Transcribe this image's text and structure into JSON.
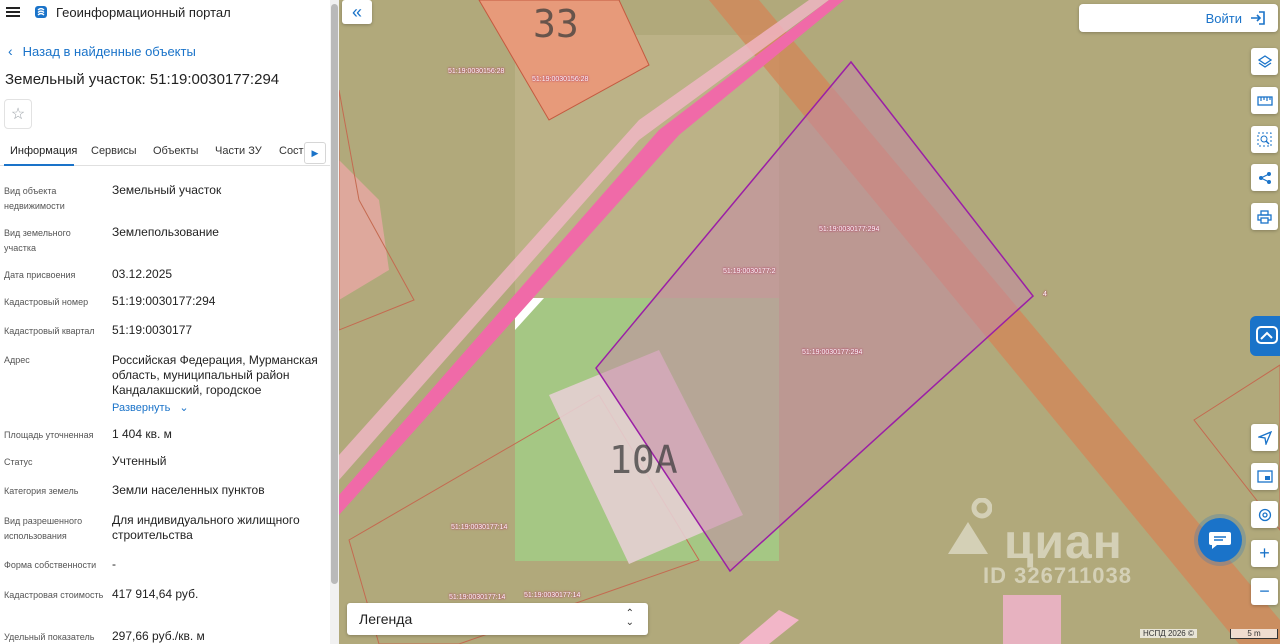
{
  "header": {
    "title": "Геоинформационный портал"
  },
  "nav": {
    "back_label": "Назад в найденные объекты"
  },
  "object": {
    "title": "Земельный участок: 51:19:0030177:294"
  },
  "tabs": [
    {
      "label": "Информация",
      "active": true
    },
    {
      "label": "Сервисы"
    },
    {
      "label": "Объекты"
    },
    {
      "label": "Части ЗУ"
    },
    {
      "label": "Соста"
    }
  ],
  "properties": [
    {
      "label": "Вид объекта недвижимости",
      "value": "Земельный участок"
    },
    {
      "label": "Вид земельного участка",
      "value": "Землепользование"
    },
    {
      "label": "Дата присвоения",
      "value": "03.12.2025"
    },
    {
      "label": "Кадастровый номер",
      "value": "51:19:0030177:294"
    },
    {
      "label": "Кадастровый квартал",
      "value": "51:19:0030177"
    },
    {
      "label": "Адрес",
      "value": "Российская Федерация, Мурманская область, муниципальный район Кандалакшский, городское"
    },
    {
      "label": "Площадь уточненная",
      "value": "1 404 кв. м"
    },
    {
      "label": "Статус",
      "value": "Учтенный"
    },
    {
      "label": "Категория земель",
      "value": "Земли населенных пунктов"
    },
    {
      "label": "Вид разрешенного использования",
      "value": "Для индивидуального жилищного строительства"
    },
    {
      "label": "Форма собственности",
      "value": "-"
    },
    {
      "label": "Кадастровая стоимость",
      "value": "417 914,64 руб."
    },
    {
      "label": "Удельный показатель",
      "value": "297,66 руб./кв. м"
    }
  ],
  "address_expand_label": "Развернуть",
  "map": {
    "login_label": "Войти",
    "legend_label": "Легенда",
    "house_numbers": [
      "33",
      "10А"
    ],
    "cadastral_labels": [
      "51:19:0030156:28",
      "51:19:0030156:28",
      "51:19:0030177:294",
      "51:19:0030177:2",
      "51:19:0030177:294",
      "4",
      "51:19:0030177:14",
      "51:19:0030177:14",
      "51:19:0030177:14"
    ],
    "watermark": "циан",
    "watermark_id": "ID 326711038",
    "attribution": "НСПД 2026 ©",
    "scale": "5 m"
  },
  "colors": {
    "accent": "#1a73c9",
    "parcel_outline": "#9b1fa6",
    "road_pink": "#f06aa8",
    "map_base": "#b1a97b"
  },
  "icons": {
    "tools": [
      "layers-icon",
      "ruler-icon",
      "select-area-icon",
      "share-icon",
      "print-icon"
    ],
    "lower_tools": [
      "locate-icon",
      "minimap-icon",
      "geo-search-icon",
      "zoom-in-icon",
      "zoom-out-icon"
    ]
  }
}
